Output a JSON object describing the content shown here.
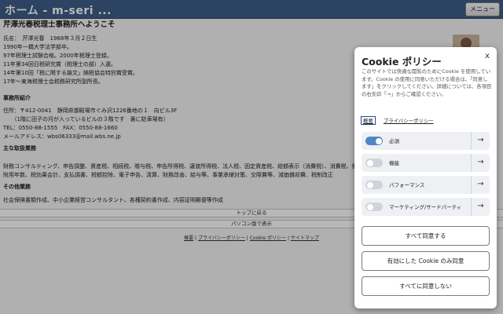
{
  "header": {
    "title": "ホーム - m-seri ...",
    "menu_label": "メニュー"
  },
  "page": {
    "title": "芹澤光春税理士事務所へようこそ",
    "profile_lines": [
      "氏名：　芹澤光春　1968年３月２日生",
      "1990年一橋大学法学部卒。",
      "97年税理士試験合格。2000年税理士登録。",
      "11年第34回日税研究賞（税理士の部）入選。",
      "14年第10回「税に関する論文」納税協会特別賞受賞。",
      "17年～東海税理士会税務研究所副所長。"
    ],
    "office_heading": "事務所紹介",
    "office_lines": [
      "住所：〒412-0041　静岡県御殿場市ぐみ沢1226番地の１　向ビル3F",
      "　　（1階に田子の月が入っているビルの３階です　裏に駐車場有）",
      "TEL：0550-88-1555　FAX：0550-88-1660",
      "メールアドレス：wbs06333@mail.wbs.ne.jp"
    ],
    "services_heading": "主な取扱業務",
    "services_lines": [
      "財務コンサルティング、申告調整、資産税、相続税、贈与税、申告所得税、譲渡所得税、法人税、固定資産税、総額表示（消費税）、消費税、償",
      "附用年数、税効果会計、支払調書、税額控除、電子申告、清算、財務改善、給与等、事業承継対策、交際費等、減価償却費、税制改正"
    ],
    "other_heading": "その他業務",
    "other_lines": [
      "社会保険書類作成、中小企業経営コンサルタント、各種契約書作成、内容証明郵便等作成"
    ],
    "back_to_top": "トップに戻る",
    "pc_version": "パソコン版で表示",
    "footer_links": [
      "概要",
      "プライバシーポリシー",
      "Cookie ポリシー",
      "サイトマップ"
    ],
    "footer_sep": "|"
  },
  "cookie_panel": {
    "title": "Cookie ポリシー",
    "close_glyph": "x",
    "description": "このサイトでは快適な閲覧のためにCookie を使用しています。Cookie の使用に同意いただける場合は、「同意します」をクリックしてください。詳細については、各項目の右矢印「→」からご確認ください。",
    "link_overview": "概要",
    "link_privacy": "プライバシーポリシー",
    "categories": [
      {
        "label": "必須",
        "enabled": true
      },
      {
        "label": "機能",
        "enabled": false
      },
      {
        "label": "パフォーマンス",
        "enabled": false
      },
      {
        "label": "マーケティング/サードパーティ",
        "enabled": false
      }
    ],
    "arrow_glyph": "→",
    "buttons": {
      "accept_all": "すべて同意する",
      "accept_selected": "有効にした Cookie のみ同意",
      "reject_all": "すべてに同意しない"
    },
    "colors": {
      "toggle_on": "#4f86c6",
      "header_bar": "#3d5e88"
    }
  }
}
